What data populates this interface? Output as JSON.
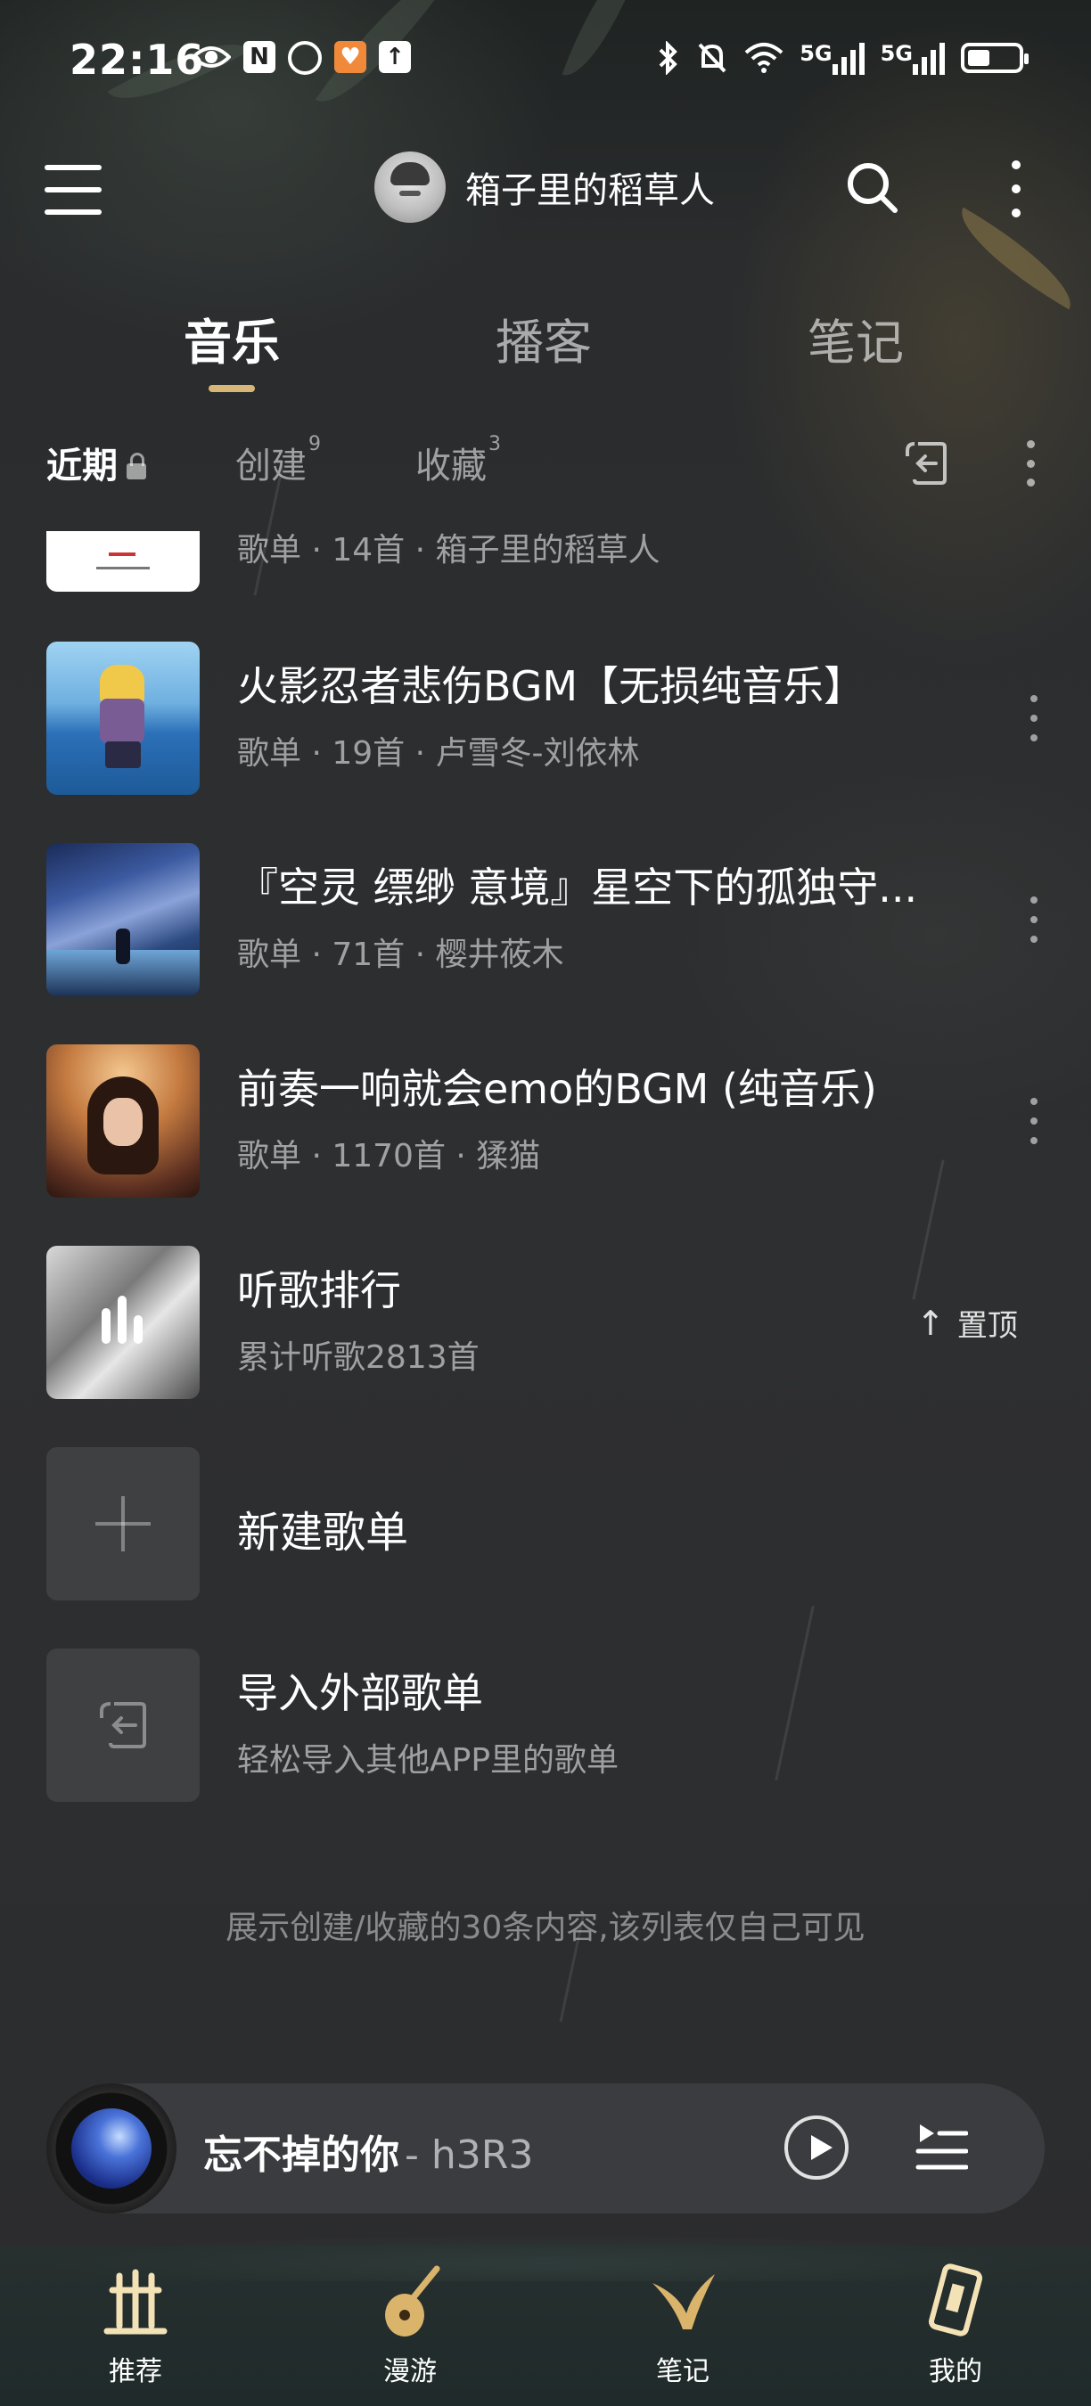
{
  "status_bar": {
    "time": "22:16",
    "left_icons": [
      "eye-icon",
      "nfc-icon",
      "alarm-icon",
      "app-badge-icon",
      "upload-icon"
    ],
    "right_icons": [
      "bluetooth-icon",
      "mute-icon",
      "wifi-icon",
      "5g-signal-icon",
      "5g-signal-icon",
      "battery-icon"
    ],
    "net_label_1": "5G",
    "net_label_2": "5G",
    "battery_level": 0.45
  },
  "header": {
    "username": "箱子里的稻草人"
  },
  "main_tabs": [
    "音乐",
    "播客",
    "笔记"
  ],
  "sub_tabs": {
    "recent": "近期",
    "created": "创建",
    "created_count": "9",
    "collected": "收藏",
    "collected_count": "3"
  },
  "playlists": [
    {
      "title": "",
      "subtitle": "歌单 · 14首 · 箱子里的稻草人"
    },
    {
      "title": "火影忍者悲伤BGM【无损纯音乐】",
      "subtitle": "歌单 · 19首 · 卢雪冬-刘依林"
    },
    {
      "title": "『空灵 缥缈 意境』星空下的孤独守...",
      "subtitle": "歌单 · 71首 · 樱井莜木"
    },
    {
      "title": "前奏一响就会emo的BGM (纯音乐)",
      "subtitle": "歌单 · 1170首 · 猱猫"
    }
  ],
  "ranking": {
    "title": "听歌排行",
    "subtitle": "累计听歌2813首",
    "pin_label": "置顶"
  },
  "new_playlist": {
    "title": "新建歌单"
  },
  "import_playlist": {
    "title": "导入外部歌单",
    "subtitle": "轻松导入其他APP里的歌单"
  },
  "footer_note": "展示创建/收藏的30条内容,该列表仅自己可见",
  "player": {
    "track": "忘不掉的你",
    "artist": "- h3R3"
  },
  "bottom_nav": [
    {
      "label": "推荐"
    },
    {
      "label": "漫游"
    },
    {
      "label": "笔记"
    },
    {
      "label": "我的"
    }
  ],
  "colors": {
    "accent": "#d8b676",
    "background": "#2b2c2e",
    "player_bg": "#3b3c3f"
  }
}
